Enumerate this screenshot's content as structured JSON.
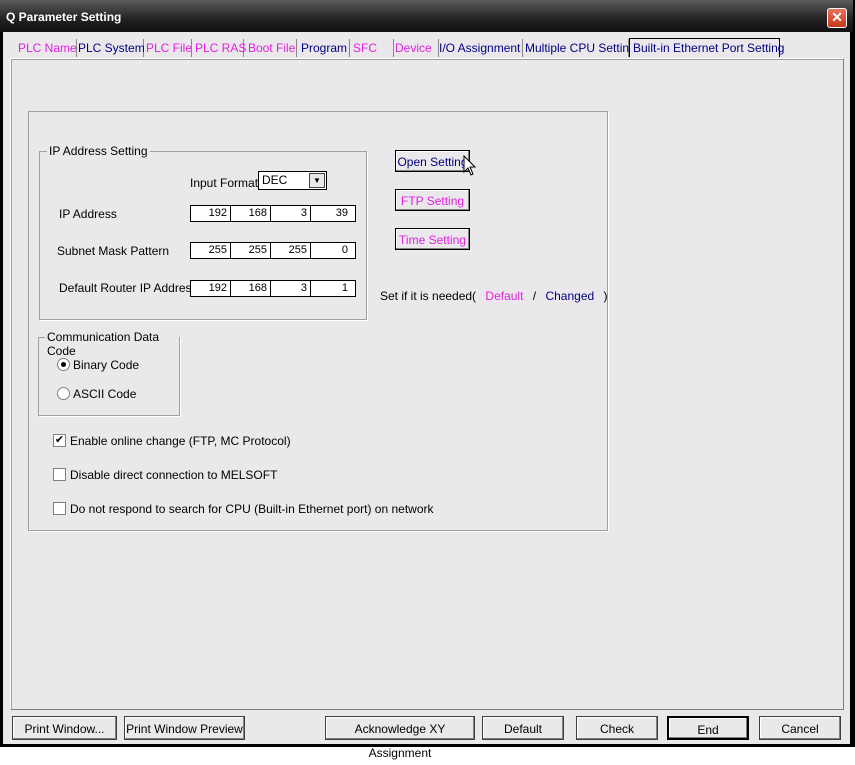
{
  "window": {
    "title": "Q Parameter Setting",
    "close_label": "✕"
  },
  "tabs": [
    {
      "label": "PLC Name"
    },
    {
      "label": "PLC System"
    },
    {
      "label": "PLC File"
    },
    {
      "label": "PLC RAS"
    },
    {
      "label": "Boot File"
    },
    {
      "label": "Program"
    },
    {
      "label": "SFC"
    },
    {
      "label": "Device"
    },
    {
      "label": "I/O Assignment"
    },
    {
      "label": "Multiple CPU Setting"
    },
    {
      "label": "Built-in Ethernet Port Setting"
    }
  ],
  "ip_setting": {
    "group_label": "IP Address Setting",
    "input_format_label": "Input Format",
    "input_format_value": "DEC",
    "ip_label": "IP Address",
    "ip": [
      "192",
      "168",
      "3",
      "39"
    ],
    "subnet_label": "Subnet Mask Pattern",
    "subnet": [
      "255",
      "255",
      "255",
      "0"
    ],
    "router_label": "Default Router IP Address",
    "router": [
      "192",
      "168",
      "3",
      "1"
    ]
  },
  "buttons": {
    "open_setting": "Open Setting",
    "ftp_setting": "FTP Setting",
    "time_setting": "Time Setting"
  },
  "set_if_needed": {
    "prefix": "Set if it is needed(",
    "default": "Default",
    "slash": "/",
    "changed": "Changed",
    "suffix": ")"
  },
  "comm_code": {
    "group_label": "Communication Data Code",
    "binary": "Binary Code",
    "ascii": "ASCII Code",
    "selected": "binary"
  },
  "options": [
    {
      "label": "Enable online change (FTP, MC Protocol)",
      "checked": true,
      "check_glyph": "✔"
    },
    {
      "label": "Disable direct connection to MELSOFT",
      "checked": false,
      "check_glyph": ""
    },
    {
      "label": "Do not respond to search for CPU (Built-in Ethernet port) on network",
      "checked": false,
      "check_glyph": ""
    }
  ],
  "footer": {
    "print_window": "Print Window...",
    "print_preview": "Print Window Preview",
    "acknowledge": "Acknowledge XY Assignment",
    "default": "Default",
    "check": "Check",
    "end": "End",
    "cancel": "Cancel"
  }
}
